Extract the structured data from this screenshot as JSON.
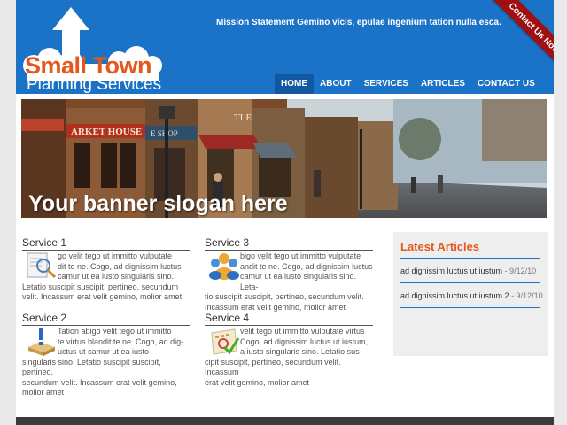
{
  "logo": {
    "title": "Small Town",
    "subtitle": "Planning Services"
  },
  "mission": "Mission Statement Gemino vícis, epulae ingenium tation nulla esca.",
  "ribbon": "Contact Us Now",
  "nav": {
    "items": [
      {
        "label": "HOME",
        "active": true
      },
      {
        "label": "ABOUT"
      },
      {
        "label": "SERVICES"
      },
      {
        "label": "ARTICLES"
      },
      {
        "label": "CONTACT US"
      }
    ],
    "social": [
      "rss-icon",
      "twitter-icon",
      "facebook-icon"
    ]
  },
  "banner": {
    "slogan": "Your banner slogan here",
    "signs": {
      "market": "ARKET HOUSE",
      "shop": "E SHOP",
      "tle": "TLE"
    }
  },
  "services": [
    {
      "title": "Service 1",
      "icon": "magnifier-document-icon",
      "indented": [
        "go velit tego ut immitto vulputate",
        "dit te ne. Cogo, ad dignissim luctus",
        "camur ut ea iusto singularis sino."
      ],
      "full": [
        "Letatio suscipit suscipit, pertineo, secundum",
        "velit. Incassum erat velit gemino, molior amet"
      ]
    },
    {
      "title": "Service 2",
      "icon": "alert-book-icon",
      "indented": [
        "Tation abigo velit tego ut immitto",
        "te virtus blandit te ne. Cogo, ad dig-",
        "uctus ut camur ut ea iusto"
      ],
      "full": [
        "singularis sino. Letatio suscipit suscipit, pertineo,",
        "secundum velit. Incassum erat velit gemino,",
        "molior amet"
      ]
    },
    {
      "title": "Service 3",
      "icon": "people-group-icon",
      "indented": [
        "bigo velit tego ut immitto vulputate",
        "andit te ne. Cogo, ad dignissim luctus",
        "camur ut ea iusto singularis sino. Leta-"
      ],
      "full": [
        "tio suscipit suscipit, pertineo, secundum velit.",
        "Incassum erat velit gemino, molior amet"
      ]
    },
    {
      "title": "Service 4",
      "icon": "calendar-check-icon",
      "indented": [
        "velit tego ut immitto vulputate virtus",
        "Cogo, ad dignissim luctus ut iustum,",
        "a iusto singularis sino. Letatio sus-"
      ],
      "full": [
        "cipit suscipit, pertineo, secundum velit. Incassum",
        "erat velit gemino, molior amet"
      ]
    }
  ],
  "articles": {
    "title": "Latest Articles",
    "items": [
      {
        "text": "ad dignissim luctus ut iustum",
        "date": " - 9/12/10"
      },
      {
        "text": "ad dignissim luctus ut iustum 2",
        "date": " - 9/12/10"
      }
    ]
  },
  "colors": {
    "header_blue": "#1a73c6",
    "accent_orange": "#e4581d",
    "ribbon_red": "#a01010"
  }
}
